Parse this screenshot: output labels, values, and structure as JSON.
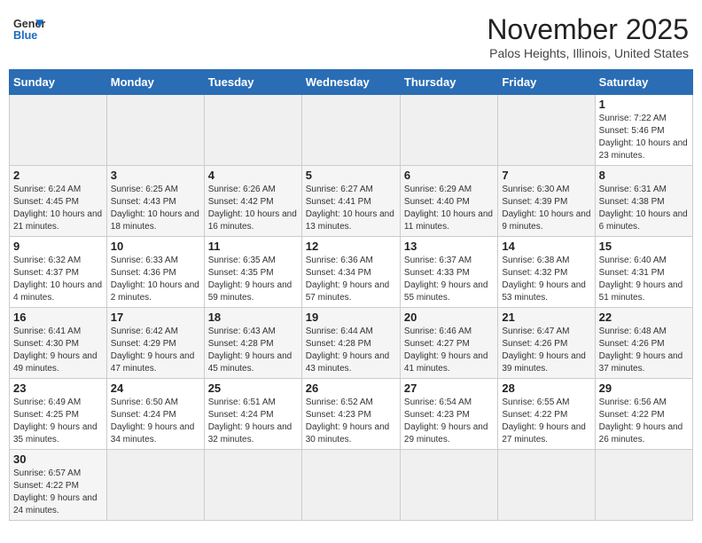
{
  "header": {
    "logo_general": "General",
    "logo_blue": "Blue",
    "month": "November 2025",
    "location": "Palos Heights, Illinois, United States"
  },
  "weekdays": [
    "Sunday",
    "Monday",
    "Tuesday",
    "Wednesday",
    "Thursday",
    "Friday",
    "Saturday"
  ],
  "weeks": [
    [
      {
        "day": "",
        "info": ""
      },
      {
        "day": "",
        "info": ""
      },
      {
        "day": "",
        "info": ""
      },
      {
        "day": "",
        "info": ""
      },
      {
        "day": "",
        "info": ""
      },
      {
        "day": "",
        "info": ""
      },
      {
        "day": "1",
        "info": "Sunrise: 7:22 AM\nSunset: 5:46 PM\nDaylight: 10 hours and 23 minutes."
      }
    ],
    [
      {
        "day": "2",
        "info": "Sunrise: 6:24 AM\nSunset: 4:45 PM\nDaylight: 10 hours and 21 minutes."
      },
      {
        "day": "3",
        "info": "Sunrise: 6:25 AM\nSunset: 4:43 PM\nDaylight: 10 hours and 18 minutes."
      },
      {
        "day": "4",
        "info": "Sunrise: 6:26 AM\nSunset: 4:42 PM\nDaylight: 10 hours and 16 minutes."
      },
      {
        "day": "5",
        "info": "Sunrise: 6:27 AM\nSunset: 4:41 PM\nDaylight: 10 hours and 13 minutes."
      },
      {
        "day": "6",
        "info": "Sunrise: 6:29 AM\nSunset: 4:40 PM\nDaylight: 10 hours and 11 minutes."
      },
      {
        "day": "7",
        "info": "Sunrise: 6:30 AM\nSunset: 4:39 PM\nDaylight: 10 hours and 9 minutes."
      },
      {
        "day": "8",
        "info": "Sunrise: 6:31 AM\nSunset: 4:38 PM\nDaylight: 10 hours and 6 minutes."
      }
    ],
    [
      {
        "day": "9",
        "info": "Sunrise: 6:32 AM\nSunset: 4:37 PM\nDaylight: 10 hours and 4 minutes."
      },
      {
        "day": "10",
        "info": "Sunrise: 6:33 AM\nSunset: 4:36 PM\nDaylight: 10 hours and 2 minutes."
      },
      {
        "day": "11",
        "info": "Sunrise: 6:35 AM\nSunset: 4:35 PM\nDaylight: 9 hours and 59 minutes."
      },
      {
        "day": "12",
        "info": "Sunrise: 6:36 AM\nSunset: 4:34 PM\nDaylight: 9 hours and 57 minutes."
      },
      {
        "day": "13",
        "info": "Sunrise: 6:37 AM\nSunset: 4:33 PM\nDaylight: 9 hours and 55 minutes."
      },
      {
        "day": "14",
        "info": "Sunrise: 6:38 AM\nSunset: 4:32 PM\nDaylight: 9 hours and 53 minutes."
      },
      {
        "day": "15",
        "info": "Sunrise: 6:40 AM\nSunset: 4:31 PM\nDaylight: 9 hours and 51 minutes."
      }
    ],
    [
      {
        "day": "16",
        "info": "Sunrise: 6:41 AM\nSunset: 4:30 PM\nDaylight: 9 hours and 49 minutes."
      },
      {
        "day": "17",
        "info": "Sunrise: 6:42 AM\nSunset: 4:29 PM\nDaylight: 9 hours and 47 minutes."
      },
      {
        "day": "18",
        "info": "Sunrise: 6:43 AM\nSunset: 4:28 PM\nDaylight: 9 hours and 45 minutes."
      },
      {
        "day": "19",
        "info": "Sunrise: 6:44 AM\nSunset: 4:28 PM\nDaylight: 9 hours and 43 minutes."
      },
      {
        "day": "20",
        "info": "Sunrise: 6:46 AM\nSunset: 4:27 PM\nDaylight: 9 hours and 41 minutes."
      },
      {
        "day": "21",
        "info": "Sunrise: 6:47 AM\nSunset: 4:26 PM\nDaylight: 9 hours and 39 minutes."
      },
      {
        "day": "22",
        "info": "Sunrise: 6:48 AM\nSunset: 4:26 PM\nDaylight: 9 hours and 37 minutes."
      }
    ],
    [
      {
        "day": "23",
        "info": "Sunrise: 6:49 AM\nSunset: 4:25 PM\nDaylight: 9 hours and 35 minutes."
      },
      {
        "day": "24",
        "info": "Sunrise: 6:50 AM\nSunset: 4:24 PM\nDaylight: 9 hours and 34 minutes."
      },
      {
        "day": "25",
        "info": "Sunrise: 6:51 AM\nSunset: 4:24 PM\nDaylight: 9 hours and 32 minutes."
      },
      {
        "day": "26",
        "info": "Sunrise: 6:52 AM\nSunset: 4:23 PM\nDaylight: 9 hours and 30 minutes."
      },
      {
        "day": "27",
        "info": "Sunrise: 6:54 AM\nSunset: 4:23 PM\nDaylight: 9 hours and 29 minutes."
      },
      {
        "day": "28",
        "info": "Sunrise: 6:55 AM\nSunset: 4:22 PM\nDaylight: 9 hours and 27 minutes."
      },
      {
        "day": "29",
        "info": "Sunrise: 6:56 AM\nSunset: 4:22 PM\nDaylight: 9 hours and 26 minutes."
      }
    ],
    [
      {
        "day": "30",
        "info": "Sunrise: 6:57 AM\nSunset: 4:22 PM\nDaylight: 9 hours and 24 minutes."
      },
      {
        "day": "",
        "info": ""
      },
      {
        "day": "",
        "info": ""
      },
      {
        "day": "",
        "info": ""
      },
      {
        "day": "",
        "info": ""
      },
      {
        "day": "",
        "info": ""
      },
      {
        "day": "",
        "info": ""
      }
    ]
  ]
}
